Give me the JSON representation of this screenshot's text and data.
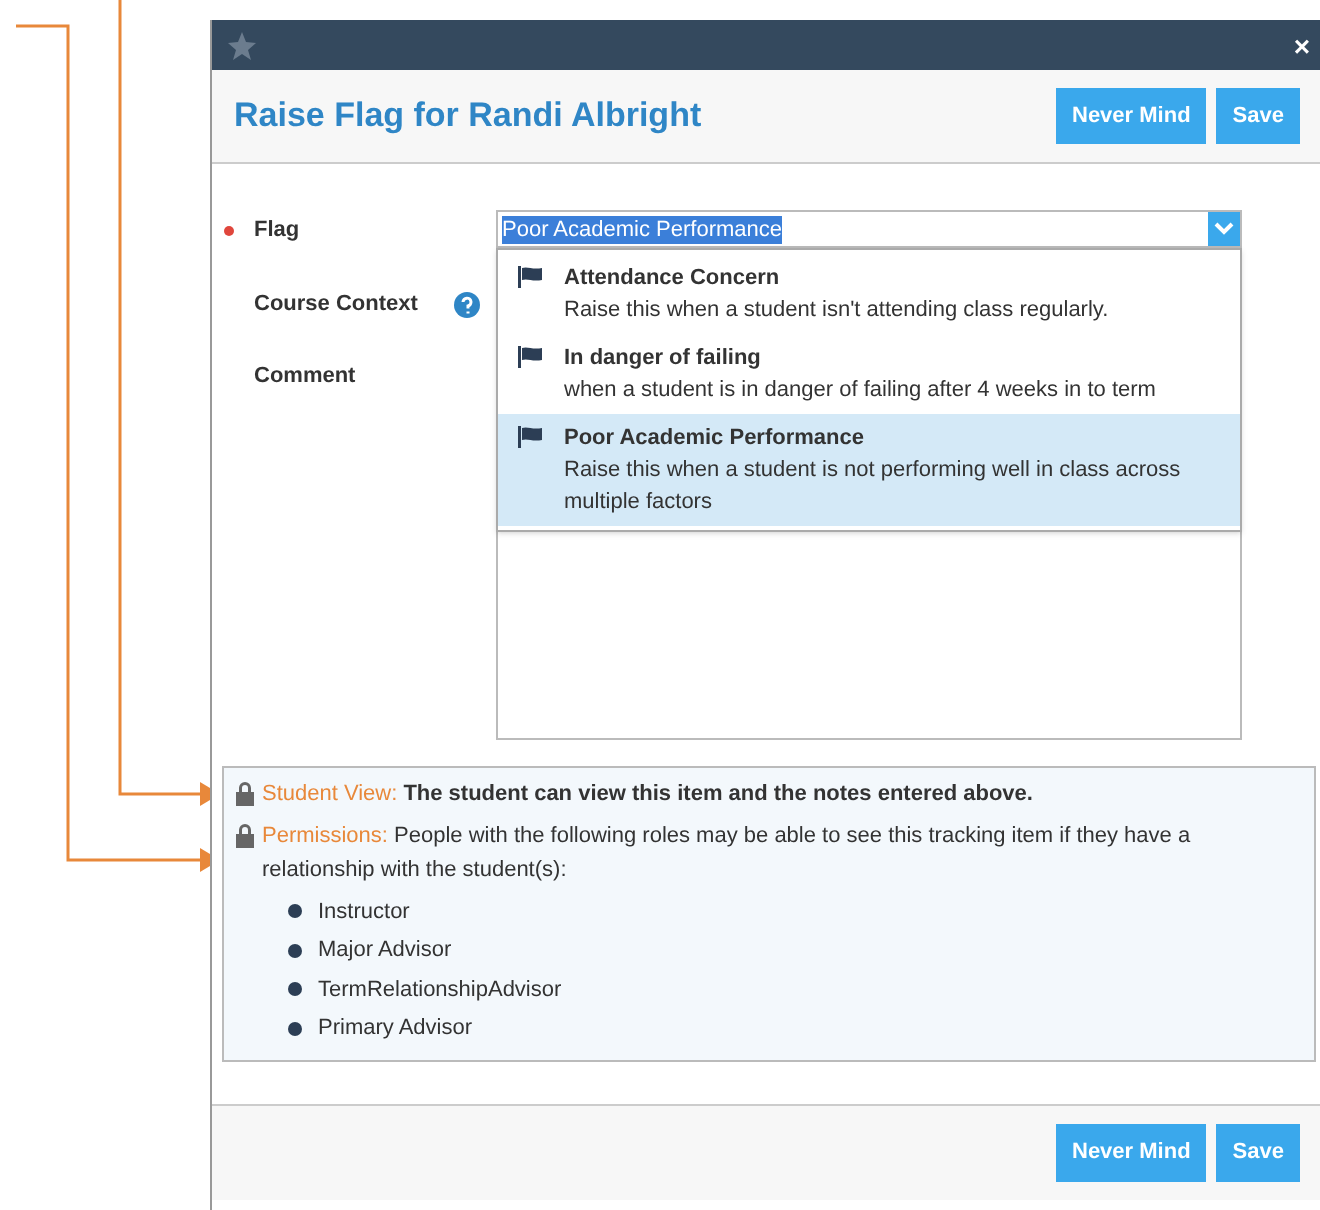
{
  "dialog": {
    "close": "×",
    "title": "Raise Flag for Randi Albright",
    "header_buttons": [
      "Never Mind",
      "Save"
    ],
    "fields": [
      {
        "kind": "select",
        "label": "Flag",
        "required": true,
        "value": "Poor Academic Performance",
        "expanded": true
      },
      {
        "kind": "context",
        "label": "Course Context",
        "required": false
      },
      {
        "kind": "textarea",
        "label": "Comment",
        "required": false
      }
    ],
    "flag_options": [
      {
        "title": "Attendance Concern",
        "description": "Raise this when a student isn't attending class regularly.",
        "selected": false
      },
      {
        "title": "In danger of failing",
        "description": "when a student is in danger of failing after 4 weeks in to term",
        "selected": false
      },
      {
        "title": "Poor Academic Performance",
        "description": "Raise this when a student is not performing well in class across multiple factors",
        "selected": true
      }
    ],
    "info": {
      "student_view": {
        "label": "Student View:",
        "text": "The student can view this item and the notes entered above."
      },
      "permissions": {
        "label": "Permissions:",
        "text": "People with the following roles may be able to see this tracking item if they have a relationship with the student(s):",
        "roles": [
          "Instructor",
          "Major Advisor",
          "TermRelationshipAdvisor",
          "Primary Advisor"
        ]
      }
    },
    "footer_buttons": [
      "Never Mind",
      "Save"
    ]
  }
}
